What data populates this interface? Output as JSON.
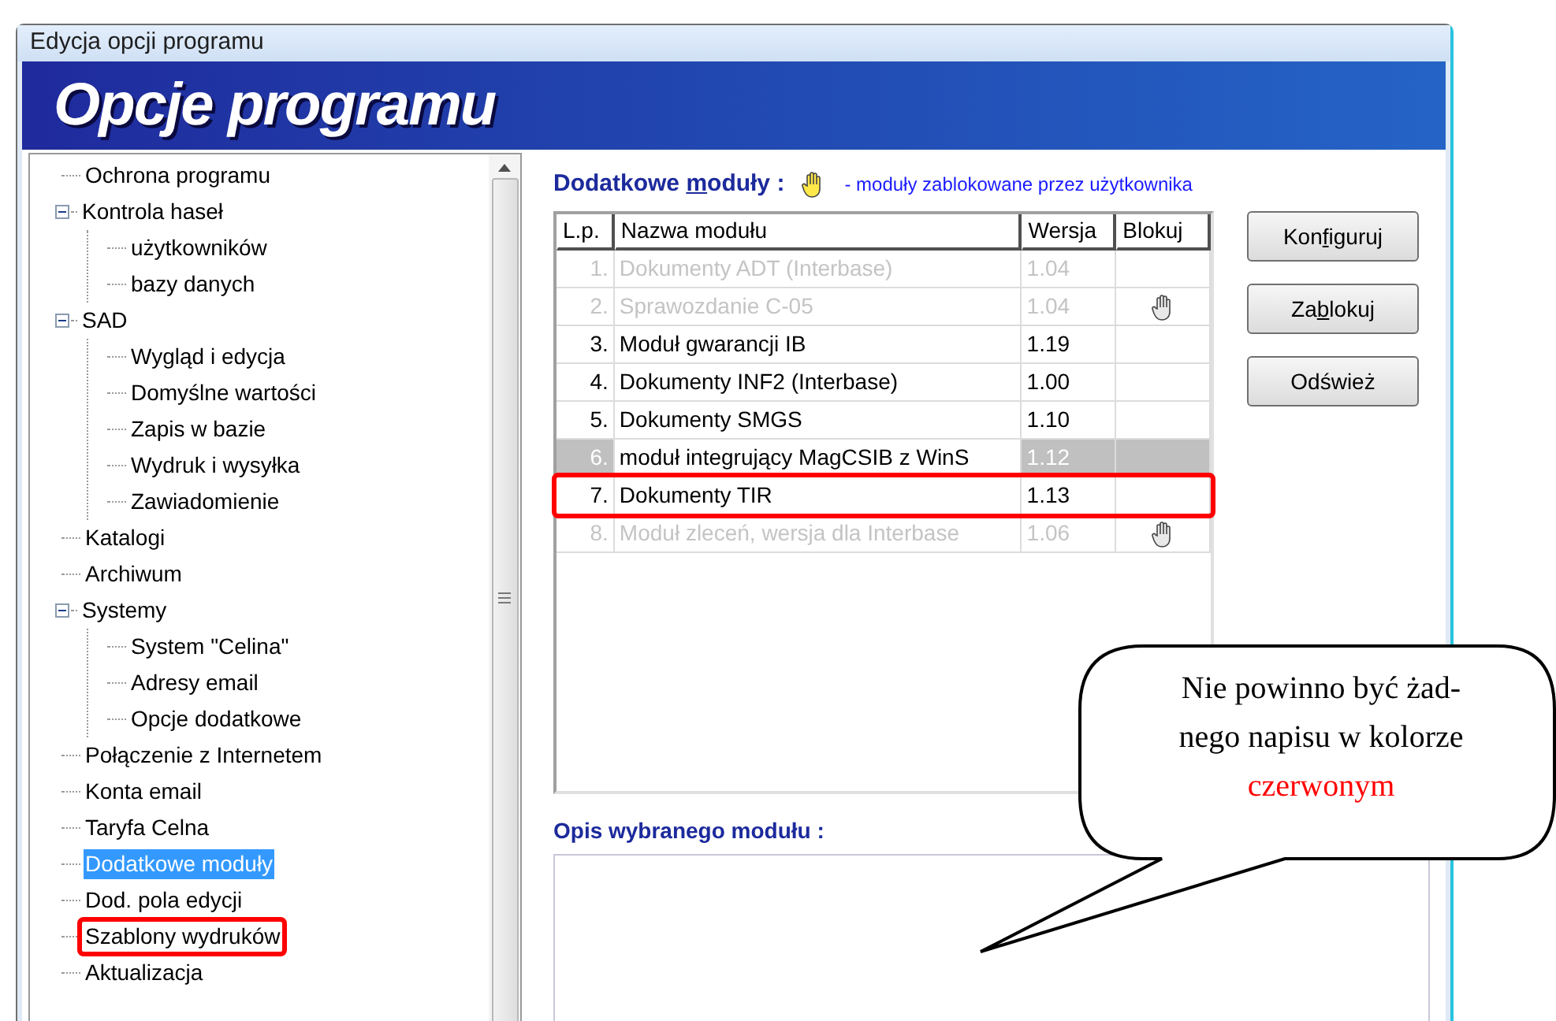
{
  "window": {
    "title": "Edycja opcji programu"
  },
  "banner": {
    "title": "Opcje programu"
  },
  "tree": [
    {
      "label": "Ochrona programu",
      "selected": false,
      "highlighted": false
    },
    {
      "label": "Kontrola haseł",
      "selected": false,
      "highlighted": false,
      "expanded": true,
      "children": [
        {
          "label": "użytkowników",
          "selected": false,
          "highlighted": false
        },
        {
          "label": "bazy danych",
          "selected": false,
          "highlighted": false
        }
      ]
    },
    {
      "label": "SAD",
      "selected": false,
      "highlighted": false,
      "expanded": true,
      "children": [
        {
          "label": "Wygląd i edycja",
          "selected": false,
          "highlighted": false
        },
        {
          "label": "Domyślne wartości",
          "selected": false,
          "highlighted": false
        },
        {
          "label": "Zapis w bazie",
          "selected": false,
          "highlighted": false
        },
        {
          "label": "Wydruk i wysyłka",
          "selected": false,
          "highlighted": false
        },
        {
          "label": "Zawiadomienie",
          "selected": false,
          "highlighted": false
        }
      ]
    },
    {
      "label": "Katalogi",
      "selected": false,
      "highlighted": false
    },
    {
      "label": "Archiwum",
      "selected": false,
      "highlighted": false
    },
    {
      "label": "Systemy",
      "selected": false,
      "highlighted": false,
      "expanded": true,
      "children": [
        {
          "label": "System \"Celina\"",
          "selected": false,
          "highlighted": false
        },
        {
          "label": "Adresy email",
          "selected": false,
          "highlighted": false
        },
        {
          "label": "Opcje dodatkowe",
          "selected": false,
          "highlighted": false
        }
      ]
    },
    {
      "label": "Połączenie z Internetem",
      "selected": false,
      "highlighted": false
    },
    {
      "label": "Konta email",
      "selected": false,
      "highlighted": false
    },
    {
      "label": "Taryfa Celna",
      "selected": false,
      "highlighted": false
    },
    {
      "label": "Dodatkowe moduły",
      "selected": true,
      "highlighted": false
    },
    {
      "label": "Dod. pola edycji",
      "selected": false,
      "highlighted": false
    },
    {
      "label": "Szablony wydruków",
      "selected": false,
      "highlighted": true
    },
    {
      "label": "Aktualizacja",
      "selected": false,
      "highlighted": false
    }
  ],
  "modules": {
    "heading": {
      "before": "Dodatkowe ",
      "key": "m",
      "after": "oduły :"
    },
    "legend": "- moduły zablokowane przez użytkownika",
    "columns": [
      "L.p.",
      "Nazwa modułu",
      "Wersja",
      "Blokuj"
    ],
    "rows": [
      {
        "lp": "1.",
        "name": "Dokumenty ADT (Interbase)",
        "version": "1.04",
        "blocked": false,
        "disabled": true,
        "selected": false,
        "highlighted": false
      },
      {
        "lp": "2.",
        "name": "Sprawozdanie C-05",
        "version": "1.04",
        "blocked": true,
        "disabled": true,
        "selected": false,
        "highlighted": false
      },
      {
        "lp": "3.",
        "name": "Moduł gwarancji IB",
        "version": "1.19",
        "blocked": false,
        "disabled": false,
        "selected": false,
        "highlighted": false
      },
      {
        "lp": "4.",
        "name": "Dokumenty INF2 (Interbase)",
        "version": "1.00",
        "blocked": false,
        "disabled": false,
        "selected": false,
        "highlighted": false
      },
      {
        "lp": "5.",
        "name": "Dokumenty SMGS",
        "version": "1.10",
        "blocked": false,
        "disabled": false,
        "selected": false,
        "highlighted": false
      },
      {
        "lp": "6.",
        "name": "moduł integrujący MagCSIB z WinS",
        "version": "1.12",
        "blocked": false,
        "disabled": false,
        "selected": true,
        "highlighted": false
      },
      {
        "lp": "7.",
        "name": "Dokumenty TIR",
        "version": "1.13",
        "blocked": false,
        "disabled": false,
        "selected": false,
        "highlighted": true
      },
      {
        "lp": "8.",
        "name": "Moduł zleceń, wersja dla Interbase",
        "version": "1.06",
        "blocked": true,
        "disabled": true,
        "selected": false,
        "highlighted": false
      }
    ],
    "buttons": [
      {
        "before": "Kon",
        "key": "f",
        "after": "iguruj"
      },
      {
        "before": "Za",
        "key": "b",
        "after": "lokuj"
      },
      {
        "before": "Odśwież"
      }
    ],
    "description_label": "Opis wybranego modułu :"
  },
  "callout": {
    "lines": [
      "Nie powinno być żad-",
      "nego napisu w kolorze"
    ],
    "emphasis": "czerwonym"
  }
}
